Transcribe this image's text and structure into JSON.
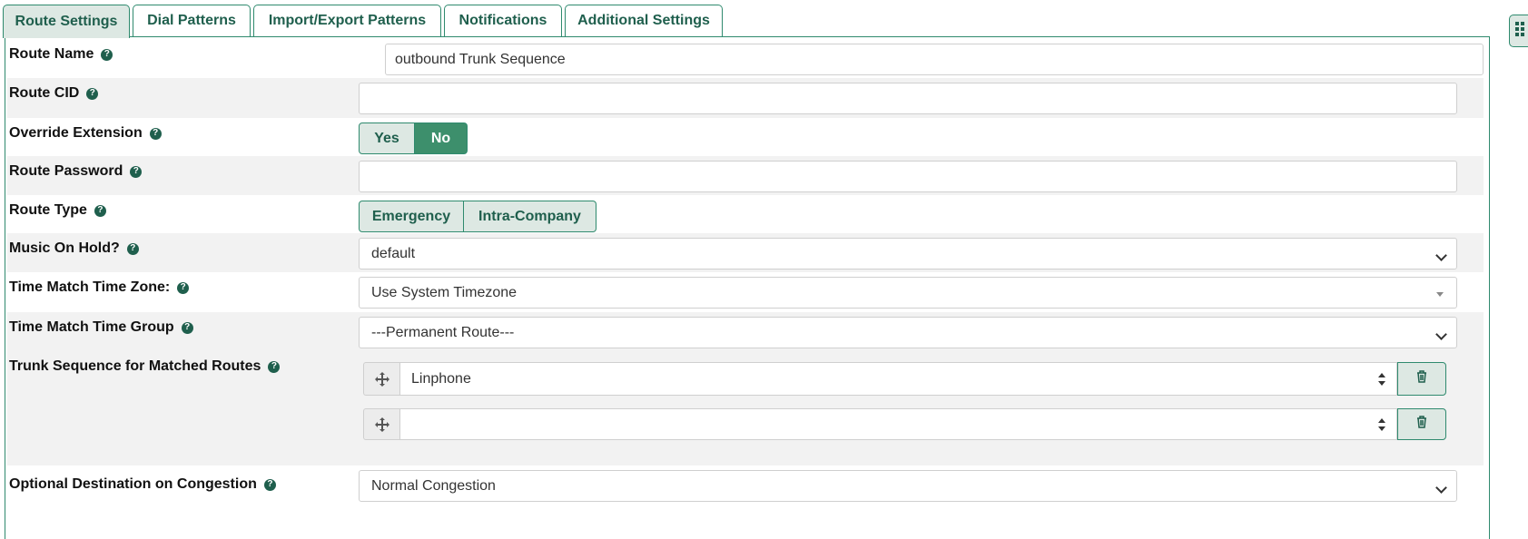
{
  "tabs": [
    {
      "label": "Route Settings",
      "active": true
    },
    {
      "label": "Dial Patterns",
      "active": false
    },
    {
      "label": "Import/Export Patterns",
      "active": false
    },
    {
      "label": "Notifications",
      "active": false
    },
    {
      "label": "Additional Settings",
      "active": false
    }
  ],
  "form": {
    "route_name": {
      "label": "Route Name",
      "value": "outbound Trunk Sequence"
    },
    "route_cid": {
      "label": "Route CID",
      "value": ""
    },
    "override_extension": {
      "label": "Override Extension",
      "yes": "Yes",
      "no": "No",
      "selected": "No"
    },
    "route_password": {
      "label": "Route Password",
      "value": ""
    },
    "route_type": {
      "label": "Route Type",
      "emergency": "Emergency",
      "intra_company": "Intra-Company"
    },
    "music_on_hold": {
      "label": "Music On Hold?",
      "value": "default"
    },
    "time_zone": {
      "label": "Time Match Time Zone:",
      "value": "Use System Timezone"
    },
    "time_group": {
      "label": "Time Match Time Group",
      "value": "---Permanent Route---"
    },
    "trunk_sequence": {
      "label": "Trunk Sequence for Matched Routes",
      "trunks": [
        "Linphone",
        ""
      ]
    },
    "congestion": {
      "label": "Optional Destination on Congestion",
      "value": "Normal Congestion"
    }
  },
  "help_glyph": "?",
  "colors": {
    "accent": "#2f8a6e",
    "accent_dark": "#1f5f4d",
    "tab_bg": "#dde8e3",
    "toggle_on": "#3d8f6c",
    "row_shade": "#f2f2f2"
  },
  "icons": [
    "question-circle-icon",
    "move-arrows-icon",
    "trash-icon",
    "grid-icon",
    "chevron-down-icon",
    "sort-arrows-icon"
  ]
}
